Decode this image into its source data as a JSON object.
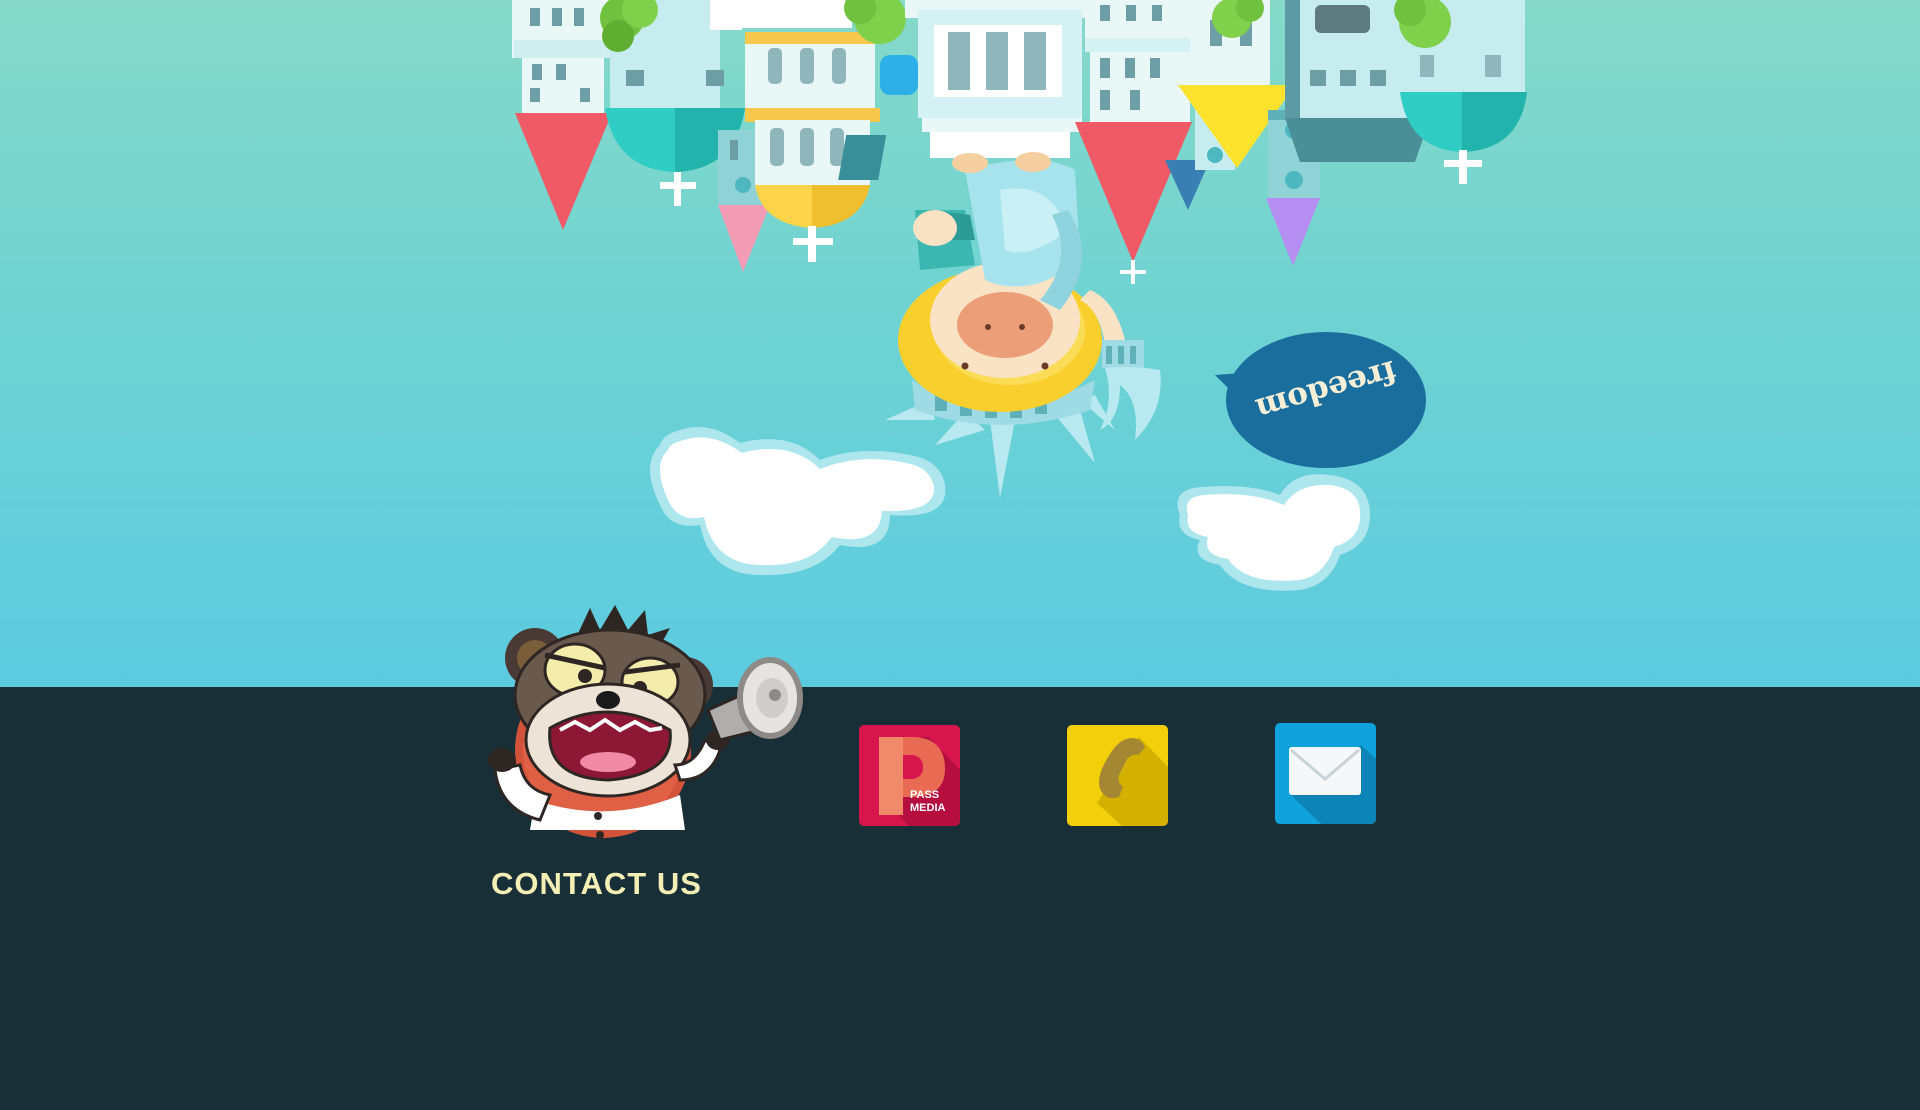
{
  "scene": {
    "speech_bubble_text": "freedom",
    "colors": {
      "sky_top": "#86d9c8",
      "sky_bottom": "#5ccbe0",
      "bubble": "#1a6e9e",
      "footer": "#182f38"
    }
  },
  "footer": {
    "contact_title": "CONTACT US",
    "title_color": "#f4efb5",
    "mascot_icon": "angry-bear-megaphone-icon",
    "links": [
      {
        "name": "passmedia",
        "label": "PASS MEDIA",
        "icon": "passmedia-logo-icon",
        "color": "#d6164d"
      },
      {
        "name": "phone",
        "label": "",
        "icon": "phone-icon",
        "color": "#f2cf0a"
      },
      {
        "name": "email",
        "label": "",
        "icon": "envelope-icon",
        "color": "#10a2dc"
      }
    ]
  }
}
